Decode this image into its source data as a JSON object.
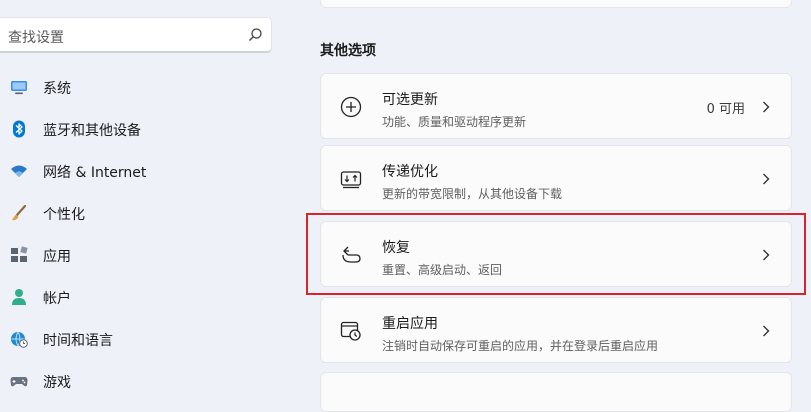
{
  "search": {
    "placeholder": "查找设置",
    "icon": "search-icon"
  },
  "sidebar": {
    "items": [
      {
        "label": "系统",
        "icon": "monitor-icon",
        "color": "#0067c0"
      },
      {
        "label": "蓝牙和其他设备",
        "icon": "bluetooth-icon",
        "color": "#0078d4"
      },
      {
        "label": "网络 & Internet",
        "icon": "wifi-icon",
        "color": "#2b78c8"
      },
      {
        "label": "个性化",
        "icon": "brush-icon",
        "color": "#c28a3a"
      },
      {
        "label": "应用",
        "icon": "apps-icon",
        "color": "#5c6472"
      },
      {
        "label": "帐户",
        "icon": "account-icon",
        "color": "#2fae8a"
      },
      {
        "label": "时间和语言",
        "icon": "globe-clock-icon",
        "color": "#1f8ad2"
      },
      {
        "label": "游戏",
        "icon": "gamepad-icon",
        "color": "#5c6472"
      }
    ]
  },
  "main": {
    "section_title": "其他选项",
    "cards": [
      {
        "title": "可选更新",
        "subtitle": "功能、质量和驱动程序更新",
        "value": "0 可用",
        "icon": "plus-circle-icon"
      },
      {
        "title": "传递优化",
        "subtitle": "更新的带宽限制，从其他设备下载",
        "value": "",
        "icon": "delivery-optimization-icon"
      },
      {
        "title": "恢复",
        "subtitle": "重置、高级启动、返回",
        "value": "",
        "icon": "recovery-icon"
      },
      {
        "title": "重启应用",
        "subtitle": "注销时自动保存可重启的应用，并在登录后重启应用",
        "value": "",
        "icon": "restart-apps-icon"
      }
    ],
    "highlight_color": "#d9262c"
  }
}
